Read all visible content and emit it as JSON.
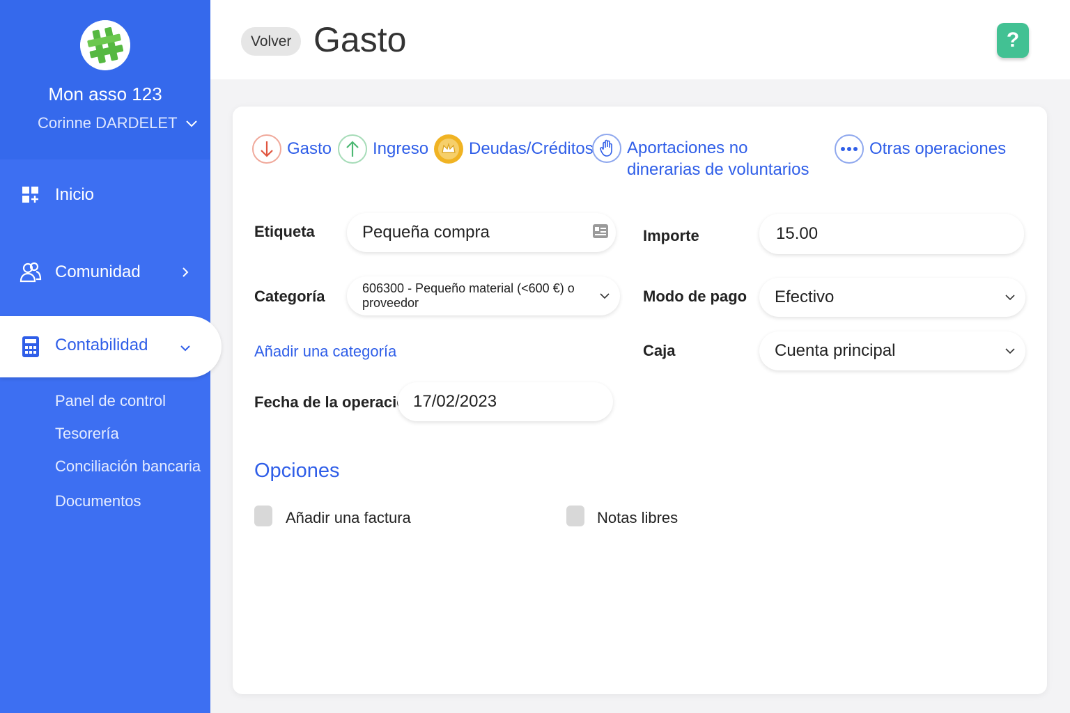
{
  "sidebar": {
    "org_name": "Mon asso 123",
    "user_name": "Corinne DARDELET",
    "nav": {
      "home": "Inicio",
      "community": "Comunidad",
      "accounting": "Contabilidad"
    },
    "sub_items": [
      "Panel de control",
      "Tesorería",
      "Conciliación bancaria",
      "Documentos"
    ]
  },
  "header": {
    "back_label": "Volver",
    "title": "Gasto",
    "help_label": "?"
  },
  "operation_tabs": {
    "expense": "Gasto",
    "income": "Ingreso",
    "debts": "Deudas/Créditos",
    "contributions_line1": "Aportaciones no",
    "contributions_line2": "dinerarias de voluntarios",
    "other": "Otras operaciones"
  },
  "form": {
    "label_label": "Etiqueta",
    "label_value": "Pequeña compra",
    "amount_label": "Importe",
    "amount_value": "15.00",
    "category_label": "Categoría",
    "category_value": "606300 - Pequeño material (<600 €) o proveedor",
    "add_category": "Añadir una categoría",
    "payment_label": "Modo de pago",
    "payment_value": "Efectivo",
    "cash_label": "Caja",
    "cash_value": "Cuenta principal",
    "date_label": "Fecha de la operación",
    "date_value": "17/02/2023"
  },
  "options": {
    "title": "Opciones",
    "add_invoice": "Añadir una factura",
    "free_notes": "Notas libres"
  },
  "colors": {
    "primary": "#3d6ff2",
    "link": "#2f5ee8",
    "help": "#42c193",
    "expense": "#e0553f",
    "income": "#4cb873",
    "debts": "#f0b323"
  }
}
